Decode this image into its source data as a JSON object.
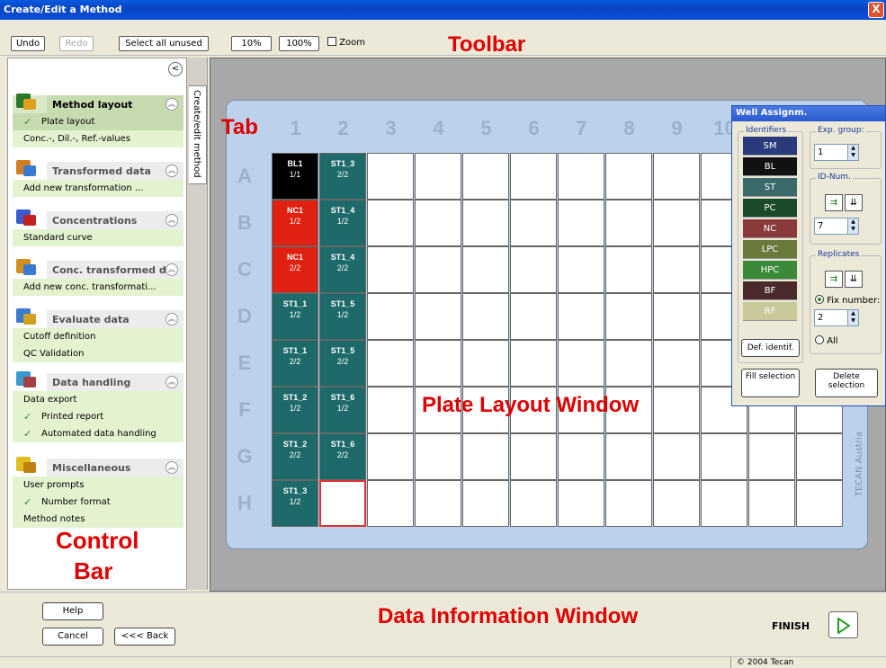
{
  "window": {
    "title": "Create/Edit a Method",
    "close": "X"
  },
  "toolbar": {
    "undo": "Undo",
    "redo": "Redo",
    "select_all_unused": "Select all unused",
    "zoom10": "10%",
    "zoom100": "100%",
    "zoom": "Zoom"
  },
  "annotations": {
    "toolbar": "Toolbar",
    "tab": "Tab",
    "plate_window": "Plate Layout Window",
    "data_window": "Data Information Window",
    "control_bar_1": "Control",
    "control_bar_2": "Bar"
  },
  "tab_label": "Create/edit method",
  "control_bar": {
    "groups": [
      {
        "label": "Method layout",
        "items": [
          {
            "label": "Plate layout",
            "checked": true
          },
          {
            "label": "Conc.-, Dil.-, Ref.-values",
            "checked": false
          }
        ]
      },
      {
        "label": "Transformed data",
        "items": [
          {
            "label": "Add new transformation ...",
            "checked": false
          }
        ]
      },
      {
        "label": "Concentrations",
        "items": [
          {
            "label": "Standard curve",
            "checked": false
          }
        ]
      },
      {
        "label": "Conc. transformed d...",
        "items": [
          {
            "label": "Add new conc. transformati...",
            "checked": false
          }
        ]
      },
      {
        "label": "Evaluate data",
        "items": [
          {
            "label": "Cutoff definition",
            "checked": false
          },
          {
            "label": "QC Validation",
            "checked": false
          }
        ]
      },
      {
        "label": "Data handling",
        "items": [
          {
            "label": "Data export",
            "checked": false
          },
          {
            "label": "Printed report",
            "checked": true
          },
          {
            "label": "Automated data handling",
            "checked": true
          }
        ]
      },
      {
        "label": "Miscellaneous",
        "items": [
          {
            "label": "User prompts",
            "checked": false
          },
          {
            "label": "Number format",
            "checked": true
          },
          {
            "label": "Method notes",
            "checked": false
          }
        ]
      }
    ]
  },
  "plate": {
    "columns": [
      "1",
      "2",
      "3",
      "4",
      "5",
      "6",
      "7",
      "8",
      "9",
      "10"
    ],
    "rows": [
      "A",
      "B",
      "C",
      "D",
      "E",
      "F",
      "G",
      "H"
    ],
    "vendor": "TECAN Austria",
    "filled": [
      {
        "row": 0,
        "col": 0,
        "name": "BL1",
        "rep": "1/1",
        "color": "#000000"
      },
      {
        "row": 1,
        "col": 0,
        "name": "NC1",
        "rep": "1/2",
        "color": "#e02010"
      },
      {
        "row": 2,
        "col": 0,
        "name": "NC1",
        "rep": "2/2",
        "color": "#e02010"
      },
      {
        "row": 3,
        "col": 0,
        "name": "ST1_1",
        "rep": "1/2",
        "color": "#1e6a6a"
      },
      {
        "row": 4,
        "col": 0,
        "name": "ST1_1",
        "rep": "2/2",
        "color": "#1e6a6a"
      },
      {
        "row": 5,
        "col": 0,
        "name": "ST1_2",
        "rep": "1/2",
        "color": "#1e6a6a"
      },
      {
        "row": 6,
        "col": 0,
        "name": "ST1_2",
        "rep": "2/2",
        "color": "#1e6a6a"
      },
      {
        "row": 7,
        "col": 0,
        "name": "ST1_3",
        "rep": "1/2",
        "color": "#1e6a6a"
      },
      {
        "row": 0,
        "col": 1,
        "name": "ST1_3",
        "rep": "2/2",
        "color": "#1e6a6a"
      },
      {
        "row": 1,
        "col": 1,
        "name": "ST1_4",
        "rep": "1/2",
        "color": "#1e6a6a"
      },
      {
        "row": 2,
        "col": 1,
        "name": "ST1_4",
        "rep": "2/2",
        "color": "#1e6a6a"
      },
      {
        "row": 3,
        "col": 1,
        "name": "ST1_5",
        "rep": "1/2",
        "color": "#1e6a6a"
      },
      {
        "row": 4,
        "col": 1,
        "name": "ST1_5",
        "rep": "2/2",
        "color": "#1e6a6a"
      },
      {
        "row": 5,
        "col": 1,
        "name": "ST1_6",
        "rep": "1/2",
        "color": "#1e6a6a"
      },
      {
        "row": 6,
        "col": 1,
        "name": "ST1_6",
        "rep": "2/2",
        "color": "#1e6a6a"
      }
    ],
    "selected": {
      "row": 7,
      "col": 1
    }
  },
  "well_panel": {
    "title": "Well Assignm.",
    "identifiers_label": "Identifiers",
    "identifiers": [
      {
        "label": "SM",
        "color": "#2a3a7a"
      },
      {
        "label": "BL",
        "color": "#111111"
      },
      {
        "label": "ST",
        "color": "#3a6a6a"
      },
      {
        "label": "PC",
        "color": "#1a4a2a"
      },
      {
        "label": "NC",
        "color": "#8a3a3a"
      },
      {
        "label": "LPC",
        "color": "#6a7a3a"
      },
      {
        "label": "HPC",
        "color": "#3a8a3a"
      },
      {
        "label": "BF",
        "color": "#4a2a2a"
      },
      {
        "label": "RF",
        "color": "#c8c89a"
      }
    ],
    "def_identif": "Def. identif.",
    "exp_group_label": "Exp. group:",
    "exp_group_value": "1",
    "id_num_label": "ID-Num.",
    "id_num_value": "7",
    "replicates_label": "Replicates",
    "fix_number_label": "Fix number:",
    "fix_number_value": "2",
    "all_label": "All",
    "fill_selection": "Fill selection",
    "delete_selection": "Delete selection"
  },
  "bottom": {
    "help": "Help",
    "cancel": "Cancel",
    "back": "<<< Back",
    "finish": "FINISH"
  },
  "status": {
    "copyright": "© 2004 Tecan"
  }
}
